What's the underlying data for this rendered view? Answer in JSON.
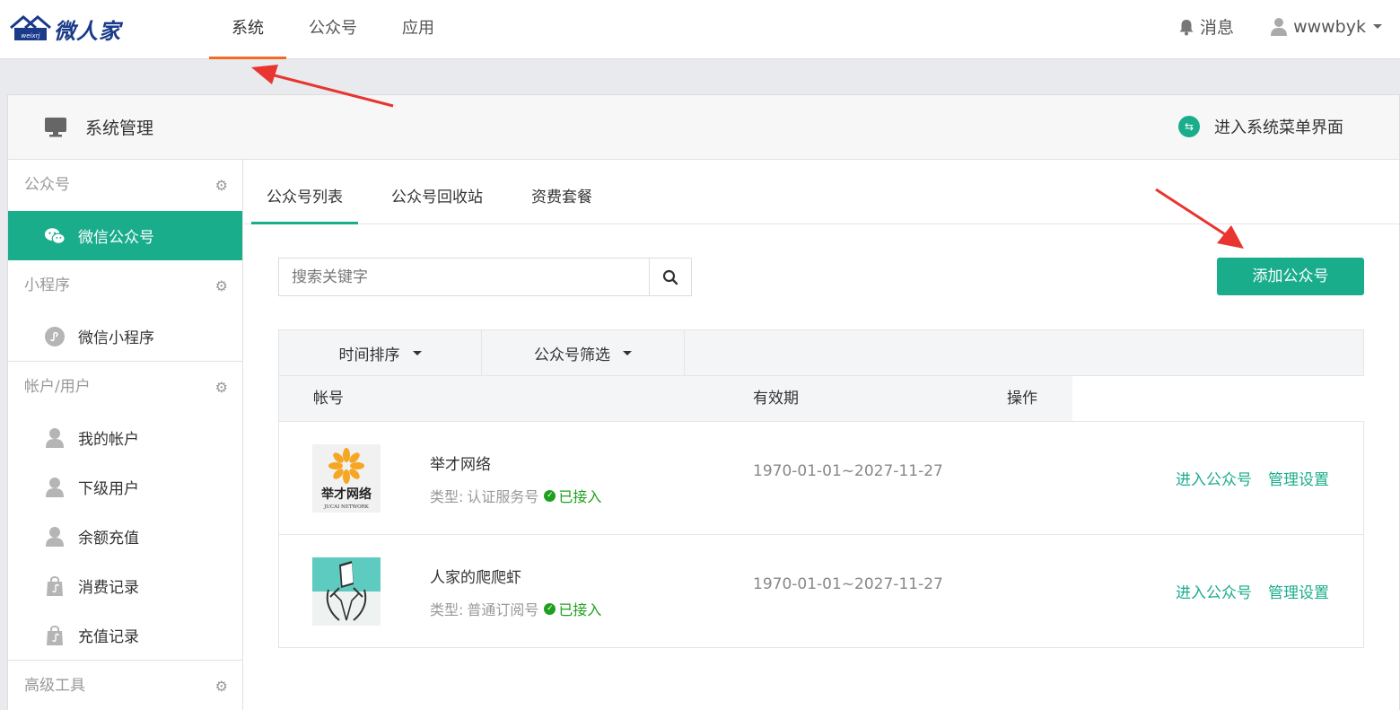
{
  "brand": {
    "logo_text": "微人家"
  },
  "topnav": {
    "items": [
      {
        "label": "系统",
        "active": true
      },
      {
        "label": "公众号",
        "active": false
      },
      {
        "label": "应用",
        "active": false
      }
    ],
    "messages_label": "消息",
    "username": "wwwbyk"
  },
  "panel": {
    "title": "系统管理",
    "enter_menu_label": "进入系统菜单界面"
  },
  "sidebar": {
    "groups": [
      {
        "label": "公众号",
        "items": [
          {
            "label": "微信公众号",
            "icon": "wechat-icon",
            "active": true
          }
        ]
      },
      {
        "label": "小程序",
        "items": [
          {
            "label": "微信小程序",
            "icon": "miniprogram-icon",
            "active": false
          }
        ]
      },
      {
        "label": "帐户/用户",
        "items": [
          {
            "label": "我的帐户",
            "icon": "user-icon"
          },
          {
            "label": "下级用户",
            "icon": "user-icon"
          },
          {
            "label": "余额充值",
            "icon": "user-icon"
          },
          {
            "label": "消费记录",
            "icon": "bag-icon"
          },
          {
            "label": "充值记录",
            "icon": "bag-icon"
          }
        ]
      },
      {
        "label": "高级工具",
        "items": []
      }
    ]
  },
  "tabs": [
    {
      "label": "公众号列表",
      "active": true
    },
    {
      "label": "公众号回收站",
      "active": false
    },
    {
      "label": "资费套餐",
      "active": false
    }
  ],
  "search": {
    "placeholder": "搜索关键字",
    "value": ""
  },
  "add_button_label": "添加公众号",
  "filters": {
    "time_sort": "时间排序",
    "account_filter": "公众号筛选"
  },
  "table": {
    "headers": {
      "account": "帐号",
      "validity": "有效期",
      "actions": "操作"
    },
    "rows": [
      {
        "name": "举才网络",
        "type_prefix": "类型:",
        "type": "认证服务号",
        "status": "已接入",
        "validity": "1970-01-01~2027-11-27",
        "enter": "进入公众号",
        "manage": "管理设置",
        "avatar_text": "举才网络",
        "avatar_sub": "JUCAI NETWORK"
      },
      {
        "name": "人家的爬爬虾",
        "type_prefix": "类型:",
        "type": "普通订阅号",
        "status": "已接入",
        "validity": "1970-01-01~2027-11-27",
        "enter": "进入公众号",
        "manage": "管理设置"
      }
    ]
  },
  "colors": {
    "accent": "#1aad8c",
    "nav_active": "#f26b21",
    "status_ok": "#1ea01e",
    "arrow": "#e8352f"
  }
}
